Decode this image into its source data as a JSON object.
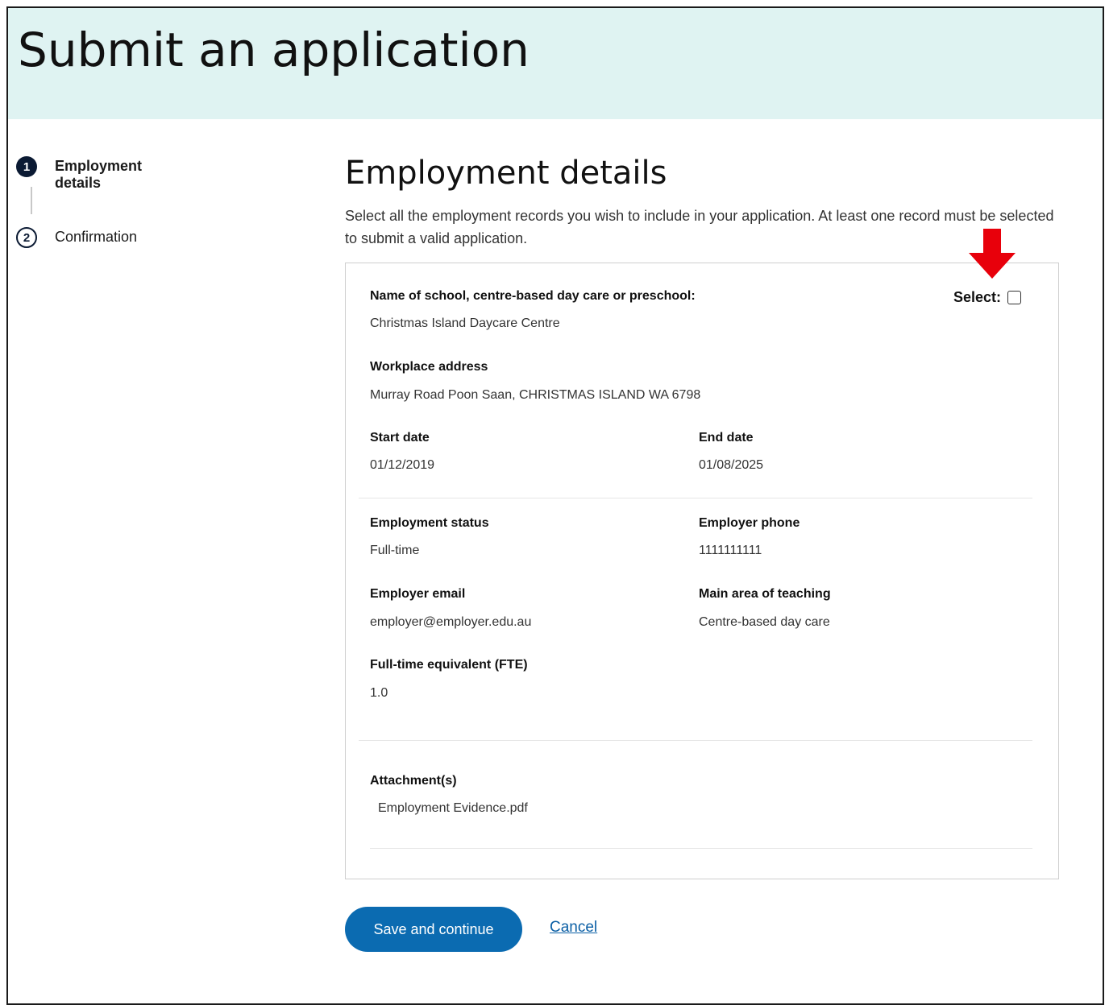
{
  "page": {
    "title": "Submit an application"
  },
  "stepper": {
    "steps": [
      {
        "number": "1",
        "label": "Employment details",
        "state": "active"
      },
      {
        "number": "2",
        "label": "Confirmation",
        "state": "todo"
      }
    ]
  },
  "section": {
    "title": "Employment details",
    "intro": "Select all the employment records you wish to include in your application. At least one record must be selected to submit a valid application."
  },
  "record": {
    "select_label": "Select:",
    "select_checked": false,
    "fields": {
      "school": {
        "label": "Name of school, centre-based day care or preschool:",
        "value": "Christmas Island Daycare Centre"
      },
      "address": {
        "label": "Workplace address",
        "value": "Murray Road Poon Saan, CHRISTMAS ISLAND WA 6798"
      },
      "start_date": {
        "label": "Start date",
        "value": "01/12/2019"
      },
      "end_date": {
        "label": "End date",
        "value": "01/08/2025"
      },
      "status": {
        "label": "Employment status",
        "value": "Full-time"
      },
      "phone": {
        "label": "Employer phone",
        "value": "1111111111"
      },
      "email": {
        "label": "Employer email",
        "value": "employer@employer.edu.au"
      },
      "teaching": {
        "label": "Main area of teaching",
        "value": "Centre-based day care"
      },
      "fte": {
        "label": "Full-time equivalent (FTE)",
        "value": "1.0"
      },
      "attachments": {
        "label": "Attachment(s)",
        "value": "Employment Evidence.pdf"
      }
    }
  },
  "actions": {
    "save_label": "Save and continue",
    "cancel_label": "Cancel"
  },
  "colors": {
    "banner": "#dff3f2",
    "primary": "#0b6bb1",
    "step_active": "#0b1a33",
    "annotation_arrow": "#e8000b"
  },
  "icons": {
    "annotation": "down-arrow-icon"
  }
}
